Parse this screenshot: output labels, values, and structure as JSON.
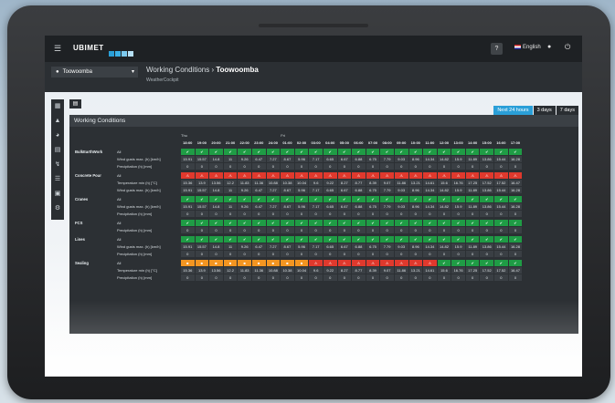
{
  "navbar": {
    "brand": "UBIMET",
    "help": "?",
    "language": "English",
    "menu_icon": "hamburger-icon",
    "user_icon": "user-icon",
    "power_icon": "power-icon"
  },
  "location": {
    "value": "Toowoomba"
  },
  "page": {
    "title_prefix": "Working Conditions",
    "title_sep": "›",
    "title_location": "Toowoomba",
    "subtitle": "WeatherCockpit"
  },
  "range": {
    "options": [
      "Next 24 hours",
      "3 days",
      "7 days"
    ],
    "selected": "Next 24 hours"
  },
  "panel": {
    "title": "Working Conditions"
  },
  "days": [
    "Thu",
    "Fri"
  ],
  "hours": [
    "18:00",
    "19:00",
    "20:00",
    "21:00",
    "22:00",
    "23:00",
    "24:00",
    "01:00",
    "02:00",
    "03:00",
    "04:00",
    "05:00",
    "06:00",
    "07:00",
    "08:00",
    "09:00",
    "10:00",
    "11:00",
    "12:00",
    "13:00",
    "14:00",
    "15:00",
    "16:00",
    "17:00"
  ],
  "sections": [
    {
      "name": "BulkEarthWork",
      "rows": [
        {
          "label": "All",
          "kind": "status",
          "cells": "gggggggggggggggggggggggg"
        },
        {
          "label": "Wind gusts max. (h) [km/h]",
          "kind": "value",
          "cells": [
            "15.91",
            "15.57",
            "14.8",
            "11",
            "9.26",
            "6.47",
            "7.27",
            "8.67",
            "5.96",
            "7.17",
            "6.65",
            "6.67",
            "6.88",
            "6.75",
            "7.79",
            "9.03",
            "8.96",
            "14.34",
            "14.82",
            "15.9",
            "11.89",
            "13.86",
            "15.44",
            "16.28"
          ]
        },
        {
          "label": "Precipitation (h) [mm]",
          "kind": "value",
          "cells": [
            "0",
            "0",
            "0",
            "0",
            "0",
            "0",
            "0",
            "0",
            "0",
            "0",
            "0",
            "0",
            "0",
            "0",
            "0",
            "0",
            "0",
            "0",
            "0",
            "0",
            "0",
            "0",
            "0",
            "0"
          ]
        }
      ]
    },
    {
      "name": "Concrete Pour",
      "rows": [
        {
          "label": "All",
          "kind": "status",
          "cells": "rrrrrrrrrrrrrrrrrrrrrrrr"
        },
        {
          "label": "Temperature min (h) [°C]",
          "kind": "value",
          "cells": [
            "15.36",
            "13.9",
            "13.56",
            "12.2",
            "11.83",
            "11.36",
            "10.88",
            "10.38",
            "10.04",
            "9.6",
            "9.22",
            "8.27",
            "8.77",
            "8.39",
            "9.07",
            "11.86",
            "13.21",
            "14.61",
            "15.6",
            "16.76",
            "17.25",
            "17.52",
            "17.52",
            "16.47"
          ]
        },
        {
          "label": "Wind gusts max. (h) [km/h]",
          "kind": "value",
          "cells": [
            "15.91",
            "15.57",
            "14.8",
            "11",
            "9.26",
            "6.47",
            "7.27",
            "8.67",
            "5.96",
            "7.17",
            "6.65",
            "6.67",
            "6.88",
            "6.75",
            "7.79",
            "9.03",
            "8.96",
            "14.34",
            "14.82",
            "15.9",
            "11.89",
            "13.86",
            "15.44",
            "16.28"
          ]
        }
      ]
    },
    {
      "name": "Cranes",
      "rows": [
        {
          "label": "All",
          "kind": "status",
          "cells": "gggggggggggggggggggggggg"
        },
        {
          "label": "Wind gusts max. (h) [km/h]",
          "kind": "value",
          "cells": [
            "15.91",
            "15.57",
            "14.8",
            "11",
            "9.26",
            "6.47",
            "7.27",
            "8.67",
            "5.96",
            "7.17",
            "6.65",
            "6.67",
            "6.88",
            "6.75",
            "7.79",
            "9.03",
            "8.96",
            "14.34",
            "14.82",
            "15.9",
            "11.89",
            "13.86",
            "15.44",
            "16.28"
          ]
        },
        {
          "label": "Precipitation (h) [mm]",
          "kind": "value",
          "cells": [
            "0",
            "0",
            "0",
            "0",
            "0",
            "0",
            "0",
            "0",
            "0",
            "0",
            "0",
            "0",
            "0",
            "0",
            "0",
            "0",
            "0",
            "0",
            "0",
            "0",
            "0",
            "0",
            "0",
            "0"
          ]
        }
      ]
    },
    {
      "name": "FCS",
      "rows": [
        {
          "label": "All",
          "kind": "status",
          "cells": "gggggggggggggggggggggggg"
        },
        {
          "label": "Precipitation (h) [mm]",
          "kind": "value",
          "cells": [
            "0",
            "0",
            "0",
            "0",
            "0",
            "0",
            "0",
            "0",
            "0",
            "0",
            "0",
            "0",
            "0",
            "0",
            "0",
            "0",
            "0",
            "0",
            "0",
            "0",
            "0",
            "0",
            "0",
            "0"
          ]
        }
      ]
    },
    {
      "name": "Lines",
      "rows": [
        {
          "label": "All",
          "kind": "status",
          "cells": "gggggggggggggggggggggggg"
        },
        {
          "label": "Wind gusts max. (h) [km/h]",
          "kind": "value",
          "cells": [
            "15.91",
            "15.57",
            "14.8",
            "11",
            "9.26",
            "6.47",
            "7.27",
            "8.67",
            "5.96",
            "7.17",
            "6.65",
            "6.67",
            "6.88",
            "6.75",
            "7.79",
            "9.03",
            "8.96",
            "14.34",
            "14.82",
            "15.9",
            "11.89",
            "13.86",
            "15.44",
            "16.28"
          ]
        },
        {
          "label": "Precipitation (h) [mm]",
          "kind": "value",
          "cells": [
            "0",
            "0",
            "0",
            "0",
            "0",
            "0",
            "0",
            "0",
            "0",
            "0",
            "0",
            "0",
            "0",
            "0",
            "0",
            "0",
            "0",
            "0",
            "0",
            "0",
            "0",
            "0",
            "0",
            "0"
          ]
        }
      ]
    },
    {
      "name": "Sealing",
      "rows": [
        {
          "label": "All",
          "kind": "status",
          "cells": "ooooooooorrrrrrrrrgggggg"
        },
        {
          "label": "Temperature min (h) [°C]",
          "kind": "value",
          "cells": [
            "15.36",
            "13.9",
            "13.56",
            "12.2",
            "11.83",
            "11.36",
            "10.88",
            "10.38",
            "10.04",
            "9.6",
            "9.22",
            "8.27",
            "8.77",
            "8.39",
            "9.07",
            "11.86",
            "13.21",
            "14.61",
            "15.6",
            "16.76",
            "17.25",
            "17.52",
            "17.52",
            "16.47"
          ]
        },
        {
          "label": "Precipitation (h) [mm]",
          "kind": "value",
          "cells": [
            "0",
            "0",
            "0",
            "0",
            "0",
            "0",
            "0",
            "0",
            "0",
            "0",
            "0",
            "0",
            "0",
            "0",
            "0",
            "0",
            "0",
            "0",
            "0",
            "0",
            "0",
            "0",
            "0",
            "0"
          ]
        }
      ]
    }
  ],
  "status_glyphs": {
    "g": "✔",
    "r": "⚠",
    "o": "■"
  },
  "colors": {
    "ok": "#1f9c45",
    "warning": "#f39521",
    "critical": "#e0392d",
    "accent": "#2a9fd8"
  }
}
